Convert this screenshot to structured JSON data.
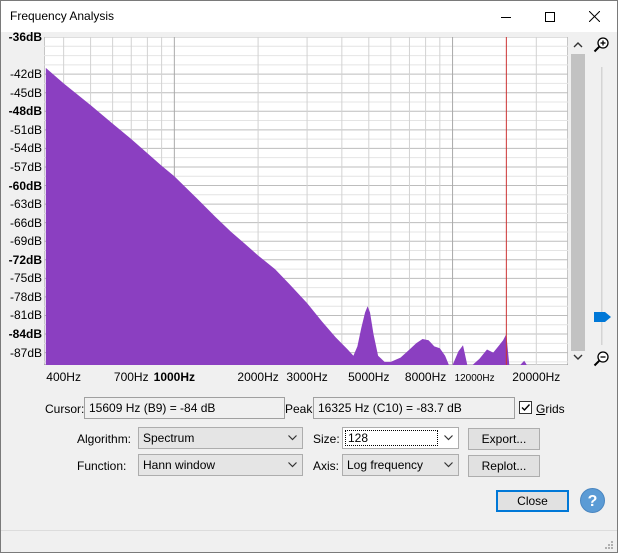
{
  "window": {
    "title": "Frequency Analysis",
    "controls": [
      "minimize-icon",
      "maximize-icon",
      "close-icon"
    ]
  },
  "chart_data": {
    "type": "area",
    "color": "#8b3fc1",
    "cursor_line_color": "#cc3333",
    "cursor_freq_hz": 15609,
    "x_scale": "log",
    "xlim": [
      340,
      26000
    ],
    "ylim": [
      -89,
      -36
    ],
    "grid": true,
    "y_ticks": [
      {
        "v": -36,
        "label": "-36dB",
        "bold": true
      },
      {
        "v": -42,
        "label": "-42dB",
        "bold": false
      },
      {
        "v": -45,
        "label": "-45dB",
        "bold": false
      },
      {
        "v": -48,
        "label": "-48dB",
        "bold": true
      },
      {
        "v": -51,
        "label": "-51dB",
        "bold": false
      },
      {
        "v": -54,
        "label": "-54dB",
        "bold": false
      },
      {
        "v": -57,
        "label": "-57dB",
        "bold": false
      },
      {
        "v": -60,
        "label": "-60dB",
        "bold": true
      },
      {
        "v": -63,
        "label": "-63dB",
        "bold": false
      },
      {
        "v": -66,
        "label": "-66dB",
        "bold": false
      },
      {
        "v": -69,
        "label": "-69dB",
        "bold": false
      },
      {
        "v": -72,
        "label": "-72dB",
        "bold": true
      },
      {
        "v": -75,
        "label": "-75dB",
        "bold": false
      },
      {
        "v": -78,
        "label": "-78dB",
        "bold": false
      },
      {
        "v": -81,
        "label": "-81dB",
        "bold": false
      },
      {
        "v": -84,
        "label": "-84dB",
        "bold": true
      },
      {
        "v": -87,
        "label": "-87dB",
        "bold": false
      }
    ],
    "x_ticks": [
      {
        "v": 400,
        "label": "400Hz",
        "style": "normal"
      },
      {
        "v": 700,
        "label": "700Hz",
        "style": "normal"
      },
      {
        "v": 1000,
        "label": "1000Hz",
        "style": "bold"
      },
      {
        "v": 2000,
        "label": "2000Hz",
        "style": "normal"
      },
      {
        "v": 3000,
        "label": "3000Hz",
        "style": "normal"
      },
      {
        "v": 5000,
        "label": "5000Hz",
        "style": "normal"
      },
      {
        "v": 8000,
        "label": "8000Hz",
        "style": "normal"
      },
      {
        "v": 12000,
        "label": "12000Hz",
        "style": "small"
      },
      {
        "v": 20000,
        "label": "20000Hz",
        "style": "normal"
      }
    ],
    "series": [
      {
        "points": [
          [
            345,
            -41
          ],
          [
            400,
            -43.5
          ],
          [
            500,
            -47
          ],
          [
            600,
            -50
          ],
          [
            700,
            -52.5
          ],
          [
            800,
            -54.8
          ],
          [
            900,
            -56.8
          ],
          [
            1000,
            -58.5
          ],
          [
            1200,
            -62
          ],
          [
            1400,
            -65
          ],
          [
            1600,
            -67.5
          ],
          [
            1800,
            -69.5
          ],
          [
            2000,
            -71.3
          ],
          [
            2300,
            -73.5
          ],
          [
            2600,
            -76
          ],
          [
            3000,
            -79
          ],
          [
            3400,
            -82
          ],
          [
            3800,
            -84.5
          ],
          [
            4200,
            -86.5
          ],
          [
            4400,
            -87.5
          ],
          [
            4550,
            -86
          ],
          [
            4700,
            -83
          ],
          [
            4850,
            -80.5
          ],
          [
            4950,
            -79.5
          ],
          [
            5050,
            -80.5
          ],
          [
            5200,
            -84
          ],
          [
            5400,
            -87.5
          ],
          [
            5700,
            -88.5
          ],
          [
            6000,
            -88.5
          ],
          [
            6500,
            -87.8
          ],
          [
            7000,
            -86.5
          ],
          [
            7400,
            -85.5
          ],
          [
            7800,
            -84.8
          ],
          [
            8200,
            -85
          ],
          [
            8600,
            -86
          ],
          [
            9000,
            -86.3
          ],
          [
            9400,
            -87.5
          ],
          [
            9700,
            -89
          ],
          [
            10000,
            -89
          ],
          [
            10500,
            -86.8
          ],
          [
            10900,
            -85.8
          ],
          [
            11300,
            -89
          ],
          [
            11800,
            -89
          ],
          [
            12500,
            -88
          ],
          [
            13300,
            -86.5
          ],
          [
            14000,
            -87
          ],
          [
            14600,
            -86
          ],
          [
            15200,
            -85
          ],
          [
            15609,
            -84
          ],
          [
            16000,
            -89
          ],
          [
            17500,
            -89
          ],
          [
            18100,
            -88.3
          ],
          [
            18500,
            -89
          ],
          [
            20000,
            -89
          ],
          [
            25500,
            -89
          ]
        ]
      }
    ]
  },
  "cursor": {
    "label": "Cursor:",
    "value": "15609 Hz (B9) = -84 dB"
  },
  "peak": {
    "label": "Peak:",
    "value": "16325 Hz (C10) = -83.7 dB"
  },
  "grids": {
    "label": "Grids",
    "checked": true
  },
  "algorithm": {
    "label": "Algorithm:",
    "value": "Spectrum"
  },
  "function": {
    "label": "Function:",
    "value": "Hann window"
  },
  "size": {
    "label": "Size:",
    "value": "128"
  },
  "axis": {
    "label": "Axis:",
    "value": "Log frequency"
  },
  "buttons": {
    "export": "Export...",
    "replot": "Replot...",
    "close": "Close",
    "help": "?"
  },
  "zoom": {
    "in_icon": "zoom-in-icon",
    "out_icon": "zoom-out-icon",
    "level": 0.9
  }
}
